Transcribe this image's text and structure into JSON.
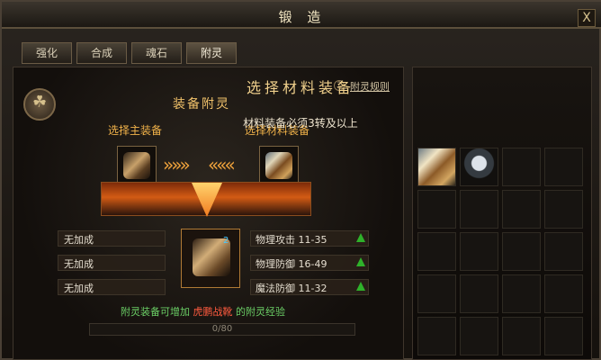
{
  "window": {
    "title": "锻 造",
    "close_label": "X"
  },
  "tabs": [
    {
      "label": "强化"
    },
    {
      "label": "合成"
    },
    {
      "label": "魂石"
    },
    {
      "label": "附灵"
    }
  ],
  "left_panel": {
    "help_label": "?",
    "help_link": "附灵规则",
    "section_title": "装备附灵",
    "main_equipment_label": "选择主装备",
    "material_equipment_label": "选择材料装备",
    "arrows_left": "»»»",
    "arrows_right": "«««",
    "left_stats": [
      "无加成",
      "无加成",
      "无加成"
    ],
    "right_stats": [
      {
        "label": "物理攻击 11-35"
      },
      {
        "label": "物理防御 16-49"
      },
      {
        "label": "魔法防御 11-32"
      }
    ],
    "center_badge": "2",
    "exp_text_prefix": "附灵装备可增加",
    "exp_text_name": "虎鹏战靴",
    "exp_text_suffix": "的附灵经验",
    "progress_text": "0/80"
  },
  "right_panel": {
    "title": "选择材料装备",
    "requirement": "材料装备必须3转及以上"
  }
}
